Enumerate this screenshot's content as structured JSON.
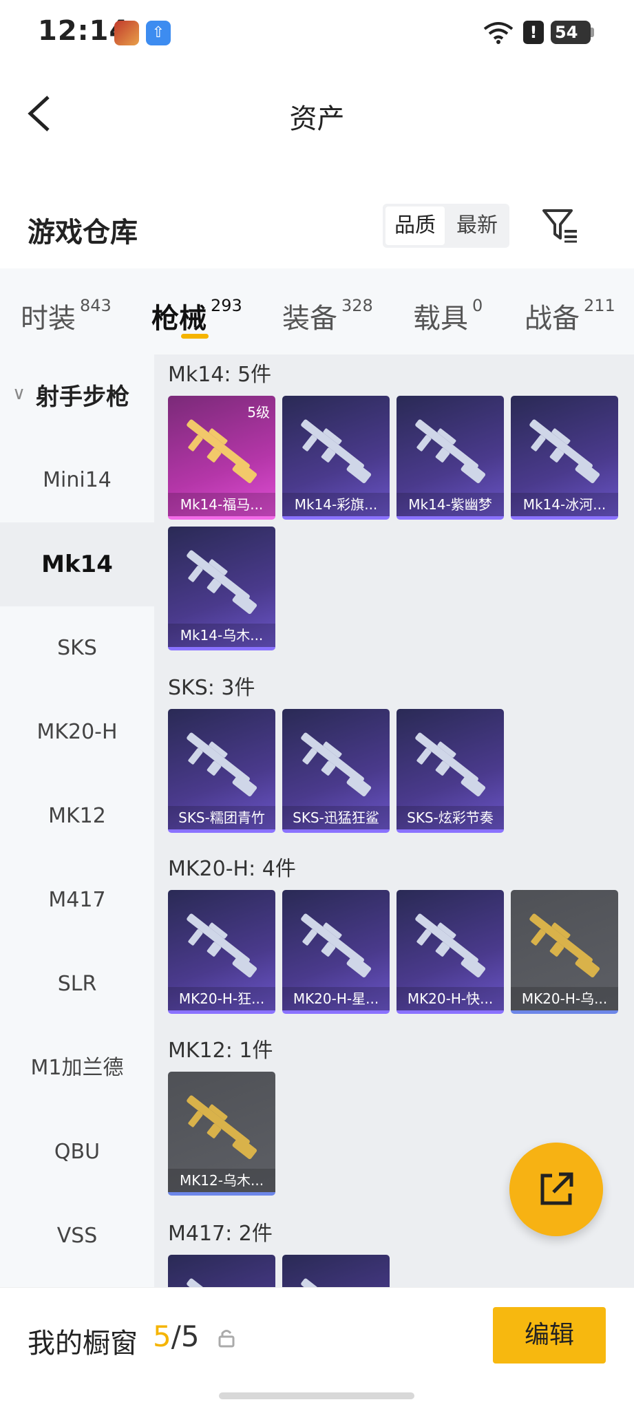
{
  "status_bar": {
    "time": "12:14",
    "battery": "54",
    "alert": "!"
  },
  "nav": {
    "title": "资产"
  },
  "header": {
    "title": "游戏仓库",
    "sort_quality": "品质",
    "sort_newest": "最新"
  },
  "tabs": [
    {
      "label": "时装",
      "count": "843"
    },
    {
      "label": "枪械",
      "count": "293"
    },
    {
      "label": "装备",
      "count": "328"
    },
    {
      "label": "载具",
      "count": "0"
    },
    {
      "label": "战备",
      "count": "211"
    }
  ],
  "sidebar": {
    "group": "射手步枪",
    "items": [
      "Mini14",
      "Mk14",
      "SKS",
      "MK20-H",
      "MK12",
      "M417",
      "SLR",
      "M1加兰德",
      "QBU",
      "VSS"
    ],
    "active": "Mk14"
  },
  "sections": [
    {
      "title": "Mk14: 5件",
      "items": [
        {
          "name": "Mk14-福马...",
          "level": "5级",
          "style": "magenta"
        },
        {
          "name": "Mk14-彩旗...",
          "style": "purple"
        },
        {
          "name": "Mk14-紫幽梦",
          "style": "purple"
        },
        {
          "name": "Mk14-冰河...",
          "style": "purple"
        },
        {
          "name": "Mk14-乌木...",
          "style": "purple"
        }
      ]
    },
    {
      "title": "SKS: 3件",
      "items": [
        {
          "name": "SKS-糯团青竹",
          "style": "purple"
        },
        {
          "name": "SKS-迅猛狂鲨",
          "style": "purple"
        },
        {
          "name": "SKS-炫彩节奏",
          "style": "purple"
        }
      ]
    },
    {
      "title": "MK20-H: 4件",
      "items": [
        {
          "name": "MK20-H-狂...",
          "style": "purple"
        },
        {
          "name": "MK20-H-星...",
          "style": "purple"
        },
        {
          "name": "MK20-H-快...",
          "style": "purple"
        },
        {
          "name": "MK20-H-乌...",
          "style": "gray"
        }
      ]
    },
    {
      "title": "MK12: 1件",
      "items": [
        {
          "name": "MK12-乌木...",
          "style": "gray"
        }
      ]
    },
    {
      "title": "M417: 2件",
      "items": [
        {
          "name": "",
          "style": "purple"
        },
        {
          "name": "",
          "style": "purple"
        }
      ]
    }
  ],
  "bottom": {
    "label": "我的橱窗",
    "current": "5",
    "separator": "/",
    "total": "5",
    "edit_label": "编辑"
  },
  "colors": {
    "accent": "#f7b80f",
    "card_purple": "#4a3a8c",
    "card_magenta": "#b436a8",
    "card_gray": "#55575c"
  }
}
